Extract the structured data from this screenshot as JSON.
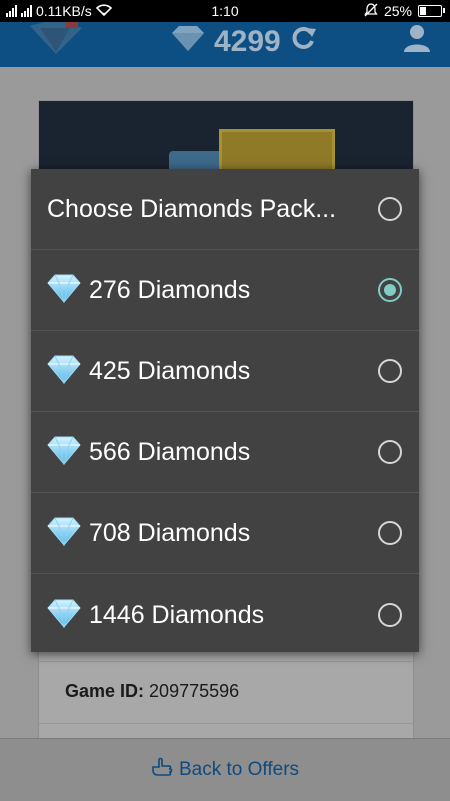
{
  "status_bar": {
    "speed": "0.11KB/s",
    "time": "1:10",
    "battery": "25%",
    "battery_level": 0.25
  },
  "header": {
    "diamonds": "4299"
  },
  "card": {
    "game_id_label": "Game ID:",
    "game_id_value": "209775596"
  },
  "bottom": {
    "back_label": "Back to Offers"
  },
  "dialog": {
    "title": "Choose Diamonds Pack...",
    "options": [
      {
        "label": "276 Diamonds",
        "selected": true
      },
      {
        "label": "425 Diamonds",
        "selected": false
      },
      {
        "label": "566 Diamonds",
        "selected": false
      },
      {
        "label": "708 Diamonds",
        "selected": false
      },
      {
        "label": "1446 Diamonds",
        "selected": false
      }
    ]
  },
  "colors": {
    "dialog_bg": "#424242",
    "radio_selected": "#80cbc4",
    "header_bg": "#0d4e83",
    "link": "#0f4a7f"
  }
}
